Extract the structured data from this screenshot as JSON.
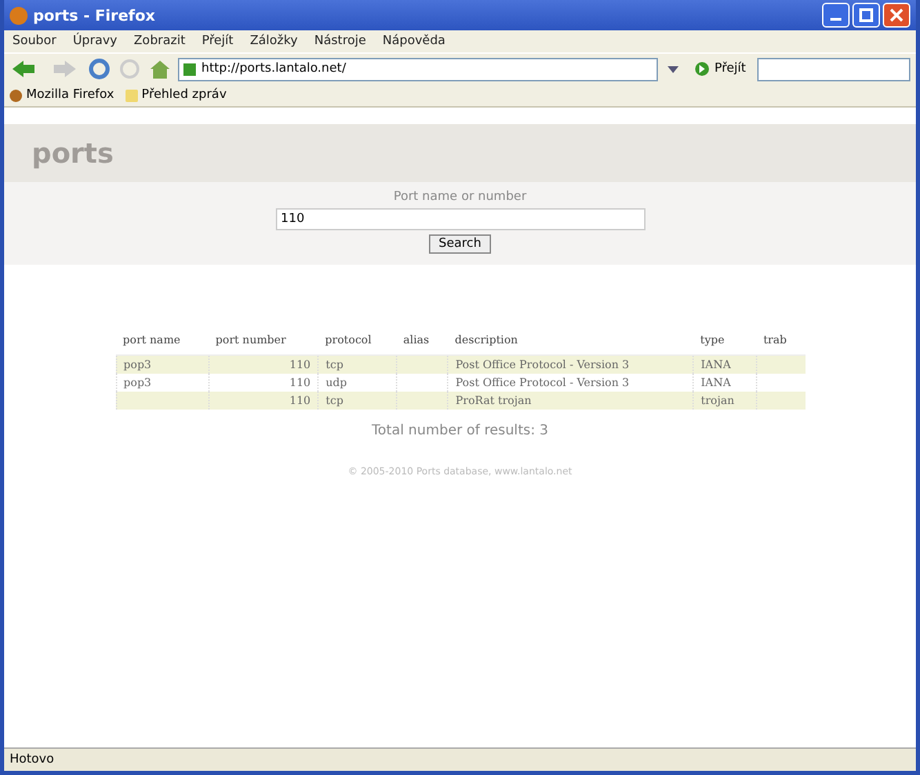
{
  "window": {
    "title": "ports - Firefox"
  },
  "menu": [
    "Soubor",
    "Úpravy",
    "Zobrazit",
    "Přejít",
    "Záložky",
    "Nástroje",
    "Nápověda"
  ],
  "address": {
    "value": "http://ports.lantalo.net/",
    "go": "Přejít"
  },
  "bookmarks": [
    "Mozilla Firefox",
    "Přehled zpráv"
  ],
  "page": {
    "heading": "ports",
    "search_label": "Port name or number",
    "search_value": "110",
    "search_button": "Search",
    "table": {
      "columns": [
        "port name",
        "port number",
        "protocol",
        "alias",
        "description",
        "type",
        "trab"
      ],
      "rows": [
        {
          "cells": [
            "pop3",
            "110",
            "tcp",
            "",
            "Post Office Protocol - Version 3",
            "IANA",
            ""
          ]
        },
        {
          "cells": [
            "pop3",
            "110",
            "udp",
            "",
            "Post Office Protocol - Version 3",
            "IANA",
            ""
          ]
        },
        {
          "cells": [
            "",
            "110",
            "tcp",
            "",
            "ProRat trojan",
            "trojan",
            ""
          ]
        }
      ]
    },
    "total": "Total number of results: 3",
    "footer": "© 2005-2010 Ports database, www.lantalo.net"
  },
  "status_bar": "Hotovo"
}
